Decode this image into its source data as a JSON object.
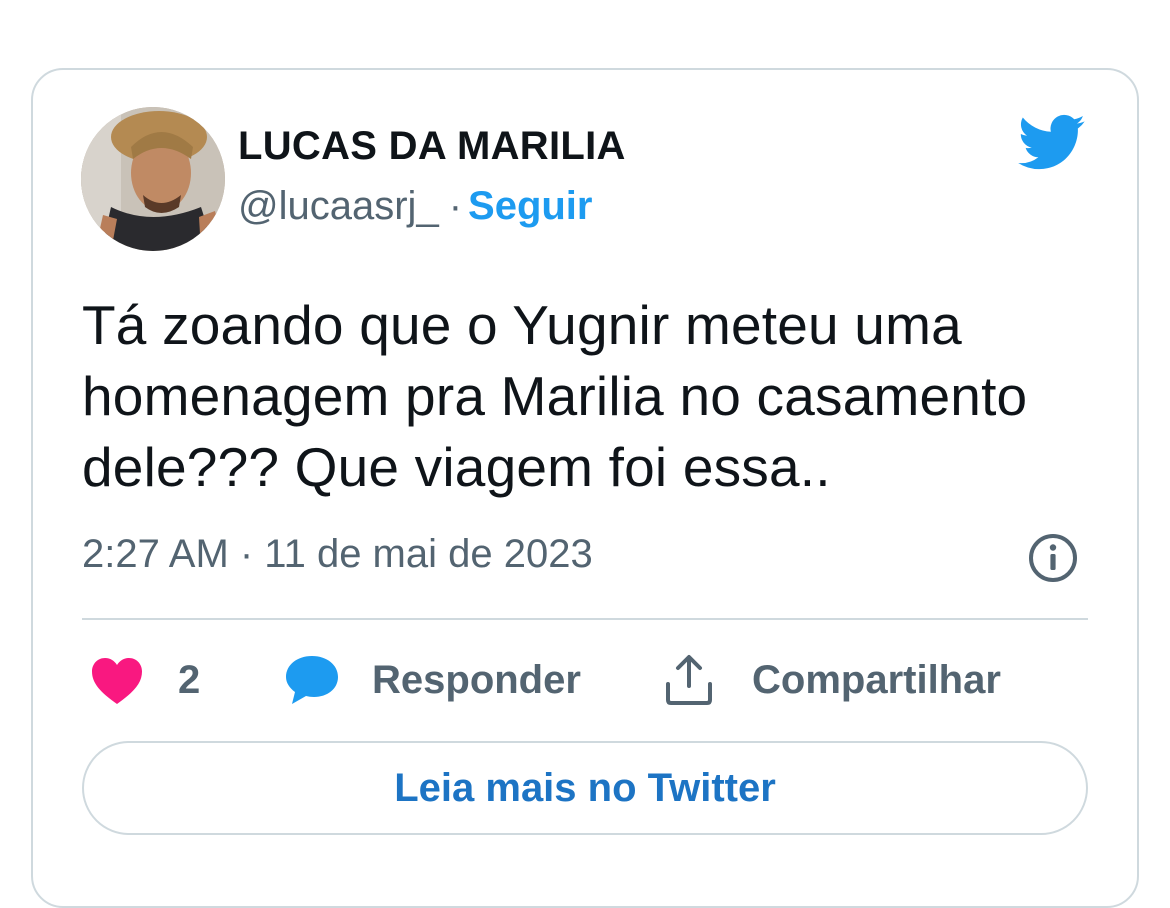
{
  "tweet": {
    "author": {
      "display_name": "LUCAS DA MARILIA",
      "handle": "@lucaasrj_",
      "separator": "·",
      "follow_label": "Seguir",
      "avatar_icon": "profile-photo"
    },
    "brand_icon": "twitter-bird-icon",
    "text": "Tá zoando que o Yugnir meteu uma homenagem pra Marilia no casamento dele??? Que viagem foi essa..",
    "timestamp": "2:27 AM · 11 de mai de 2023",
    "info_icon": "info-circle-icon",
    "actions": {
      "like_icon": "heart-icon",
      "like_count": "2",
      "reply_icon": "speech-bubble-icon",
      "reply_label": "Responder",
      "share_icon": "share-upload-icon",
      "share_label": "Compartilhar"
    },
    "read_more_label": "Leia mais no Twitter"
  },
  "colors": {
    "accent": "#1d9bf0",
    "like": "#f91880",
    "text_primary": "#0f1419",
    "text_secondary": "#536471",
    "border": "#cfd9de",
    "read_more_text": "#1d74c4"
  }
}
